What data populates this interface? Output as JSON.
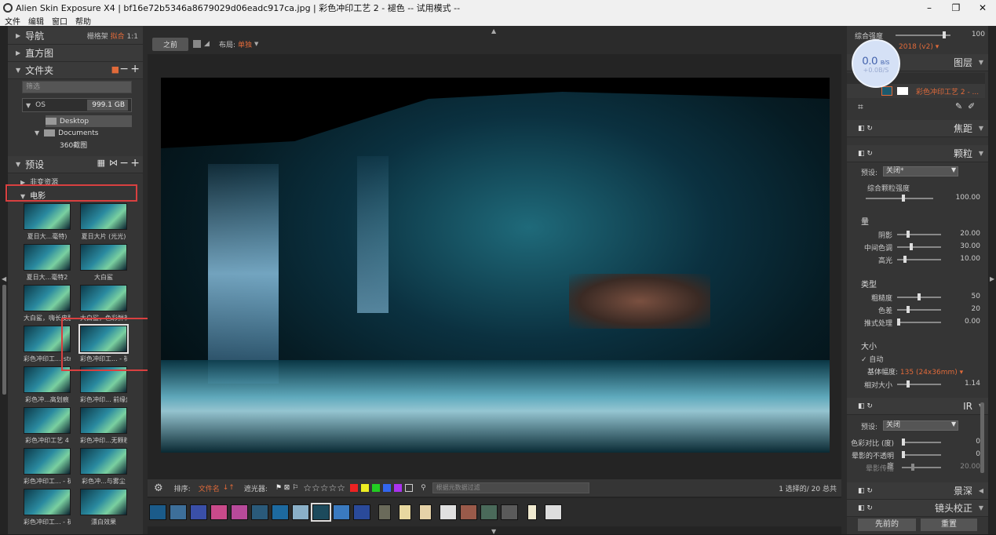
{
  "window": {
    "title": "Alien Skin Exposure X4 | bf16e72b5346a8679029d06eadc917ca.jpg | 彩色冲印工艺 2 - 褪色 -- 试用模式 --",
    "minimize": "–",
    "maximize": "❐",
    "close": "✕"
  },
  "menu": [
    "文件",
    "编辑",
    "窗口",
    "帮助"
  ],
  "left_panel": {
    "nav_label": "导航",
    "nav_options": {
      "grid": "栅格架",
      "fit": "拟合",
      "ratio": "1:1"
    },
    "histogram_label": "直方图",
    "folders_label": "文件夹",
    "filter_placeholder": "筛选",
    "drive_name": "OS",
    "drive_size": "999.1 GB",
    "folders": [
      "Desktop",
      "Documents",
      "360截图"
    ],
    "presets_label": "预设",
    "preset_groups": [
      "非变资源",
      "电影"
    ],
    "thumbnails": [
      "夏日大...毫特)",
      "夏日大片 (光光)",
      "夏日大...毫特2",
      "大白鲨",
      "大白鲨，嗨长皮肤",
      "大白鲨，色彩鲜艳",
      "彩色冲印工...(strip)",
      "彩色冲印工... - 褪色",
      "彩色冲...高划痕",
      "彩色冲印... 前缘角",
      "彩色冲印工艺 4",
      "彩色冲印...无颗粒)",
      "彩色冲印工... - 褪色",
      "彩色冲...与雾尘",
      "彩色冲印工... - 褪日",
      "漂白效果"
    ]
  },
  "center": {
    "before_button": "之前",
    "layout_label": "布局:",
    "layout_value": "单独",
    "sort_label": "排序:",
    "sort_value": "文件名",
    "filter_label": "遮光器:",
    "stars": "☆☆☆☆☆",
    "search_placeholder": "根据元数据过滤",
    "selection_count": "1 选择的/ 20 总共",
    "color_labels": [
      "#e22",
      "#ee2",
      "#2c2",
      "#36e",
      "#a3e"
    ]
  },
  "right_panel": {
    "overall_strength_label": "综合强度",
    "overall_strength_value": "100",
    "version": "2018 (v2)",
    "layers_label": "图层",
    "layer_name": "彩色冲印工艺 2 - ...",
    "sections": [
      "焦距",
      "颗粒",
      "IR",
      "景深",
      "镜头校正"
    ],
    "grain": {
      "preset_label": "预设:",
      "preset_value": "关闭*",
      "overall_label": "综合颗粒强度",
      "overall_value": "100.00",
      "amount_title": "量",
      "shadows_label": "阴影",
      "shadows_value": "20.00",
      "midtones_label": "中间色调",
      "midtones_value": "30.00",
      "highlights_label": "高光",
      "highlights_value": "10.00",
      "type_title": "类型",
      "roughness_label": "粗糙度",
      "roughness_value": "50",
      "color_label": "色差",
      "color_value": "20",
      "push_label": "推式处理",
      "push_value": "0.00",
      "size_title": "大小",
      "auto_label": "自动",
      "film_width_label": "基体幅度:",
      "film_width_value": "135 (24x36mm)",
      "relative_size_label": "相对大小",
      "relative_size_value": "1.14"
    },
    "ir": {
      "preset_label": "预设:",
      "preset_value": "关闭",
      "contrast_label": "色彩对比 (度)",
      "contrast_value": "0",
      "halo_opacity_label": "晕影的不透明度",
      "halo_opacity_value": "0",
      "halo_spread_label": "晕影传播",
      "halo_spread_value": "20.00"
    },
    "prev_button": "先前的",
    "reset_button": "重置"
  },
  "overlay": {
    "speed": "0.0",
    "speed_unit": "B/S",
    "sub": "+0.0B/S"
  }
}
